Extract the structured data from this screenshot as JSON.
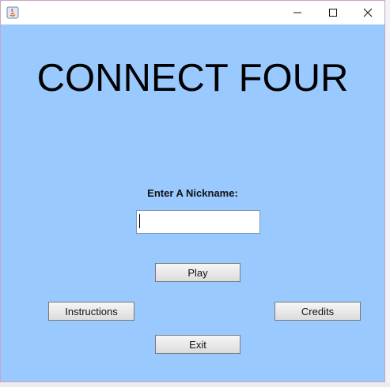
{
  "window": {
    "title_bar_text": "",
    "controls": {
      "minimize_icon": "minimize-icon",
      "maximize_icon": "maximize-icon",
      "close_icon": "close-icon"
    },
    "background_color": "#99c9ff"
  },
  "main": {
    "title": "CONNECT FOUR",
    "nickname_label": "Enter A Nickname:",
    "nickname_value": "",
    "buttons": {
      "play": "Play",
      "instructions": "Instructions",
      "credits": "Credits",
      "exit": "Exit"
    }
  }
}
